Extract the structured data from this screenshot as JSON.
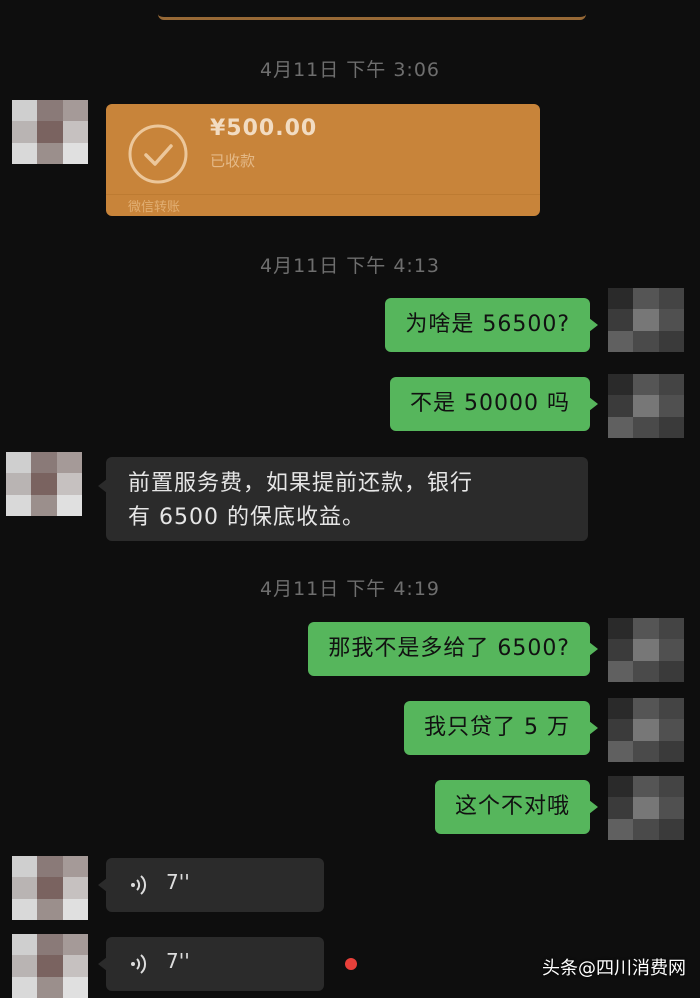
{
  "chat": {
    "timestamps": [
      "4月11日 下午 3:06",
      "4月11日 下午 4:13",
      "4月11日 下午 4:19"
    ],
    "transfer": {
      "amount": "¥500.00",
      "status": "已收款",
      "label": "微信转账",
      "accent_color": "#c8843a",
      "icon": "check-circle-icon"
    },
    "messages": [
      {
        "direction": "out",
        "text": "为啥是 56500?"
      },
      {
        "direction": "out",
        "text": "不是 50000 吗"
      },
      {
        "direction": "in",
        "lines": [
          "前置服务费，如果提前还款，银行",
          "有 6500 的保底收益。"
        ]
      },
      {
        "direction": "out",
        "text": "那我不是多给了 6500?"
      },
      {
        "direction": "out",
        "text": "我只贷了 5 万"
      },
      {
        "direction": "out",
        "text": "这个不对哦"
      }
    ],
    "voice_messages": [
      {
        "duration": "7''",
        "icon": "voice-wave-icon"
      },
      {
        "duration": "7''",
        "icon": "voice-wave-icon",
        "unread": true
      }
    ]
  },
  "watermark": "头条@四川消费网",
  "colors": {
    "background": "#0e0e0e",
    "outgoing_bubble": "#56b65c",
    "incoming_bubble": "#2b2b2b",
    "unread_dot": "#e8403a"
  }
}
